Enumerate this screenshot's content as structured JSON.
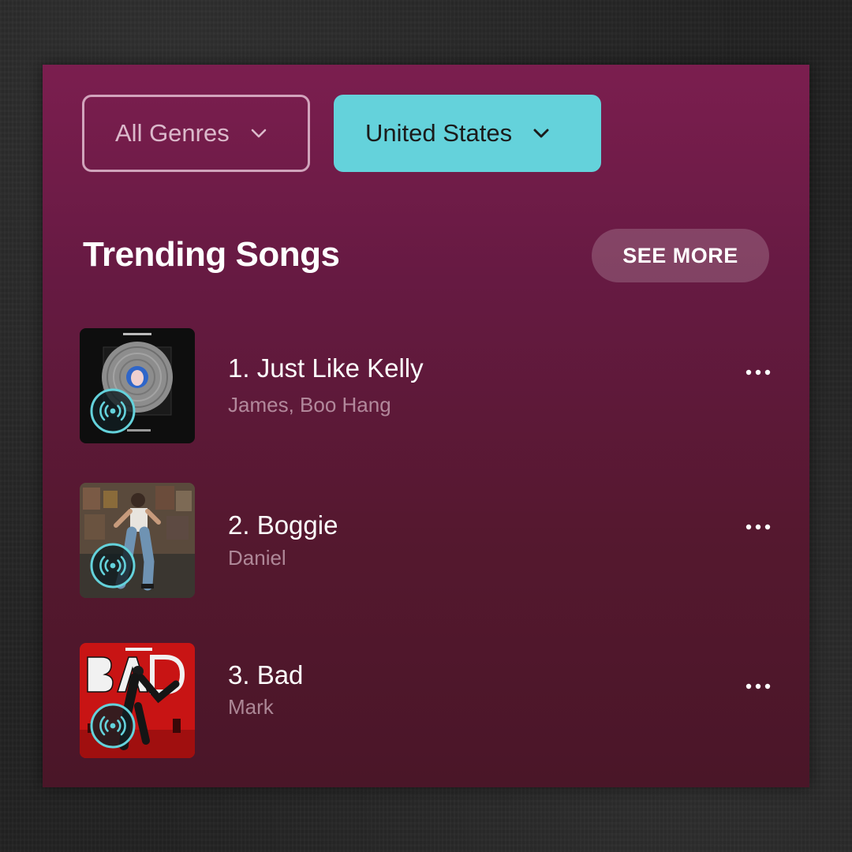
{
  "filters": {
    "genre": {
      "value": "All Genres",
      "icon": "chevron-down-icon"
    },
    "country": {
      "value": "United States",
      "icon": "chevron-down-icon"
    }
  },
  "section": {
    "title": "Trending Songs",
    "see_more_label": "SEE MORE"
  },
  "songs": [
    {
      "title": "1. Just Like Kelly",
      "artist": "James, Boo Hang",
      "badge_icon": "live-radio-icon",
      "menu_icon": "more-horizontal-icon"
    },
    {
      "title": "2. Boggie",
      "artist": "Daniel",
      "badge_icon": "live-radio-icon",
      "menu_icon": "more-horizontal-icon"
    },
    {
      "title": "3. Bad",
      "artist": "Mark",
      "badge_icon": "live-radio-icon",
      "menu_icon": "more-horizontal-icon"
    }
  ],
  "colors": {
    "accent": "#64d2db",
    "panel_top": "#7b1e4f",
    "panel_bottom": "#4a1628"
  }
}
